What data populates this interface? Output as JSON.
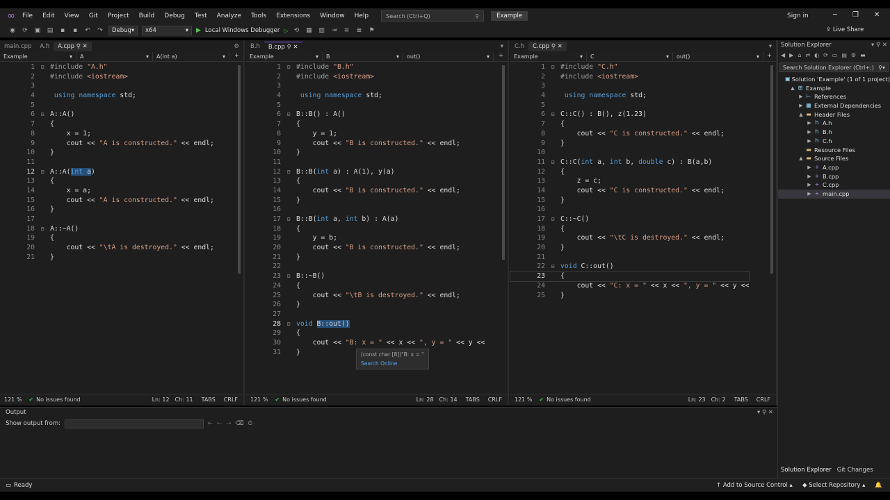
{
  "menubar": {
    "items": [
      "File",
      "Edit",
      "View",
      "Git",
      "Project",
      "Build",
      "Debug",
      "Test",
      "Analyze",
      "Tools",
      "Extensions",
      "Window",
      "Help"
    ],
    "search_placeholder": "Search (Ctrl+Q)",
    "solution_badge": "Example",
    "sign_in": "Sign in"
  },
  "toolbar": {
    "config": "Debug",
    "platform": "x64",
    "run_label": "Local Windows Debugger",
    "live_share": "Live Share"
  },
  "panes": [
    {
      "tabs": [
        "main.cpp",
        "A.h",
        "A.cpp"
      ],
      "active_tab": 2,
      "nav": [
        "Example",
        "A",
        "A(int a)"
      ],
      "current_line": 12,
      "lines": [
        "#include \"A.h\"",
        "#include <iostream>",
        "",
        " using namespace std;",
        "",
        "A::A()",
        "{",
        "    x = 1;",
        "    cout << \"A is constructed.\" << endl;",
        "}",
        "",
        "A::A(int a)",
        "{",
        "    x = a;",
        "    cout << \"A is constructed.\" << endl;",
        "}",
        "",
        "A::~A()",
        "{",
        "    cout << \"\\tA is destroyed.\" << endl;",
        "}"
      ],
      "status": {
        "zoom": "121 %",
        "issues": "No issues found",
        "ln": "Ln: 12",
        "ch": "Ch: 11",
        "tabs": "TABS",
        "eol": "CRLF"
      }
    },
    {
      "tabs": [
        "B.h",
        "B.cpp"
      ],
      "active_tab": 1,
      "nav": [
        "Example",
        "B",
        "out()"
      ],
      "current_line": 28,
      "lines": [
        "#include \"B.h\"",
        "#include <iostream>",
        "",
        " using namespace std;",
        "",
        "B::B() : A()",
        "{",
        "    y = 1;",
        "    cout << \"B is constructed.\" << endl;",
        "}",
        "",
        "B::B(int a) : A(1), y(a)",
        "{",
        "    cout << \"B is constructed.\" << endl;",
        "}",
        "",
        "B::B(int a, int b) : A(a)",
        "{",
        "    y = b;",
        "    cout << \"B is constructed.\" << endl;",
        "}",
        "",
        "B::~B()",
        "{",
        "    cout << \"\\tB is destroyed.\" << endl;",
        "}",
        "",
        "void B::out()",
        "{",
        "    cout << \"B: x = \" << x << \", y = \" << y <<",
        "}"
      ],
      "status": {
        "zoom": "121 %",
        "issues": "No issues found",
        "ln": "Ln: 28",
        "ch": "Ch: 14",
        "tabs": "TABS",
        "eol": "CRLF"
      },
      "tooltip": {
        "text": "(const char [8])\"B: x = \"",
        "link": "Search Online"
      }
    },
    {
      "tabs": [
        "C.h",
        "C.cpp"
      ],
      "active_tab": 1,
      "nav": [
        "Example",
        "C",
        "out()"
      ],
      "current_line": 23,
      "lines": [
        "#include \"C.h\"",
        "#include <iostream>",
        "",
        " using namespace std;",
        "",
        "C::C() : B(), z(1.23)",
        "{",
        "    cout << \"C is constructed.\" << endl;",
        "}",
        "",
        "C::C(int a, int b, double c) : B(a,b)",
        "{",
        "    z = c;",
        "    cout << \"C is constructed.\" << endl;",
        "}",
        "",
        "C::~C()",
        "{",
        "    cout << \"\\tC is destroyed.\" << endl;",
        "}",
        "",
        "void C::out()",
        "{",
        "    cout << \"C: x = \" << x << \", y = \" << y <<",
        "}"
      ],
      "status": {
        "zoom": "121 %",
        "issues": "No issues found",
        "ln": "Ln: 23",
        "ch": "Ch: 2",
        "tabs": "TABS",
        "eol": "CRLF"
      }
    }
  ],
  "solution_explorer": {
    "title": "Solution Explorer",
    "search_placeholder": "Search Solution Explorer (Ctrl+;)",
    "tree": [
      {
        "label": "Solution 'Example' (1 of 1 project)",
        "depth": 0,
        "icon": "solution-icon",
        "twisty": ""
      },
      {
        "label": "Example",
        "depth": 1,
        "icon": "project-icon",
        "twisty": "▲"
      },
      {
        "label": "References",
        "depth": 2,
        "icon": "references-icon",
        "twisty": "▶"
      },
      {
        "label": "External Dependencies",
        "depth": 2,
        "icon": "dependencies-icon",
        "twisty": "▶"
      },
      {
        "label": "Header Files",
        "depth": 2,
        "icon": "folder-icon",
        "twisty": "▲"
      },
      {
        "label": "A.h",
        "depth": 3,
        "icon": "header-file-icon",
        "twisty": "▶"
      },
      {
        "label": "B.h",
        "depth": 3,
        "icon": "header-file-icon",
        "twisty": "▶"
      },
      {
        "label": "C.h",
        "depth": 3,
        "icon": "header-file-icon",
        "twisty": "▶"
      },
      {
        "label": "Resource Files",
        "depth": 2,
        "icon": "folder-icon",
        "twisty": ""
      },
      {
        "label": "Source Files",
        "depth": 2,
        "icon": "folder-icon",
        "twisty": "▲"
      },
      {
        "label": "A.cpp",
        "depth": 3,
        "icon": "cpp-file-icon",
        "twisty": "▶"
      },
      {
        "label": "B.cpp",
        "depth": 3,
        "icon": "cpp-file-icon",
        "twisty": "▶"
      },
      {
        "label": "C.cpp",
        "depth": 3,
        "icon": "cpp-file-icon",
        "twisty": "▶"
      },
      {
        "label": "main.cpp",
        "depth": 3,
        "icon": "cpp-file-icon",
        "twisty": "▶",
        "selected": true
      }
    ],
    "bottom_tabs": [
      "Solution Explorer",
      "Git Changes"
    ]
  },
  "output": {
    "title": "Output",
    "show_from_label": "Show output from:"
  },
  "statusbar": {
    "ready": "Ready",
    "source_control": "Add to Source Control",
    "select_repo": "Select Repository"
  },
  "colors": {
    "keyword": "#569cd6",
    "string": "#d69d85",
    "preprocessor": "#9b9b9b",
    "selection": "#264f78",
    "accent": "#8b5cf6",
    "ok": "#3fb950"
  }
}
